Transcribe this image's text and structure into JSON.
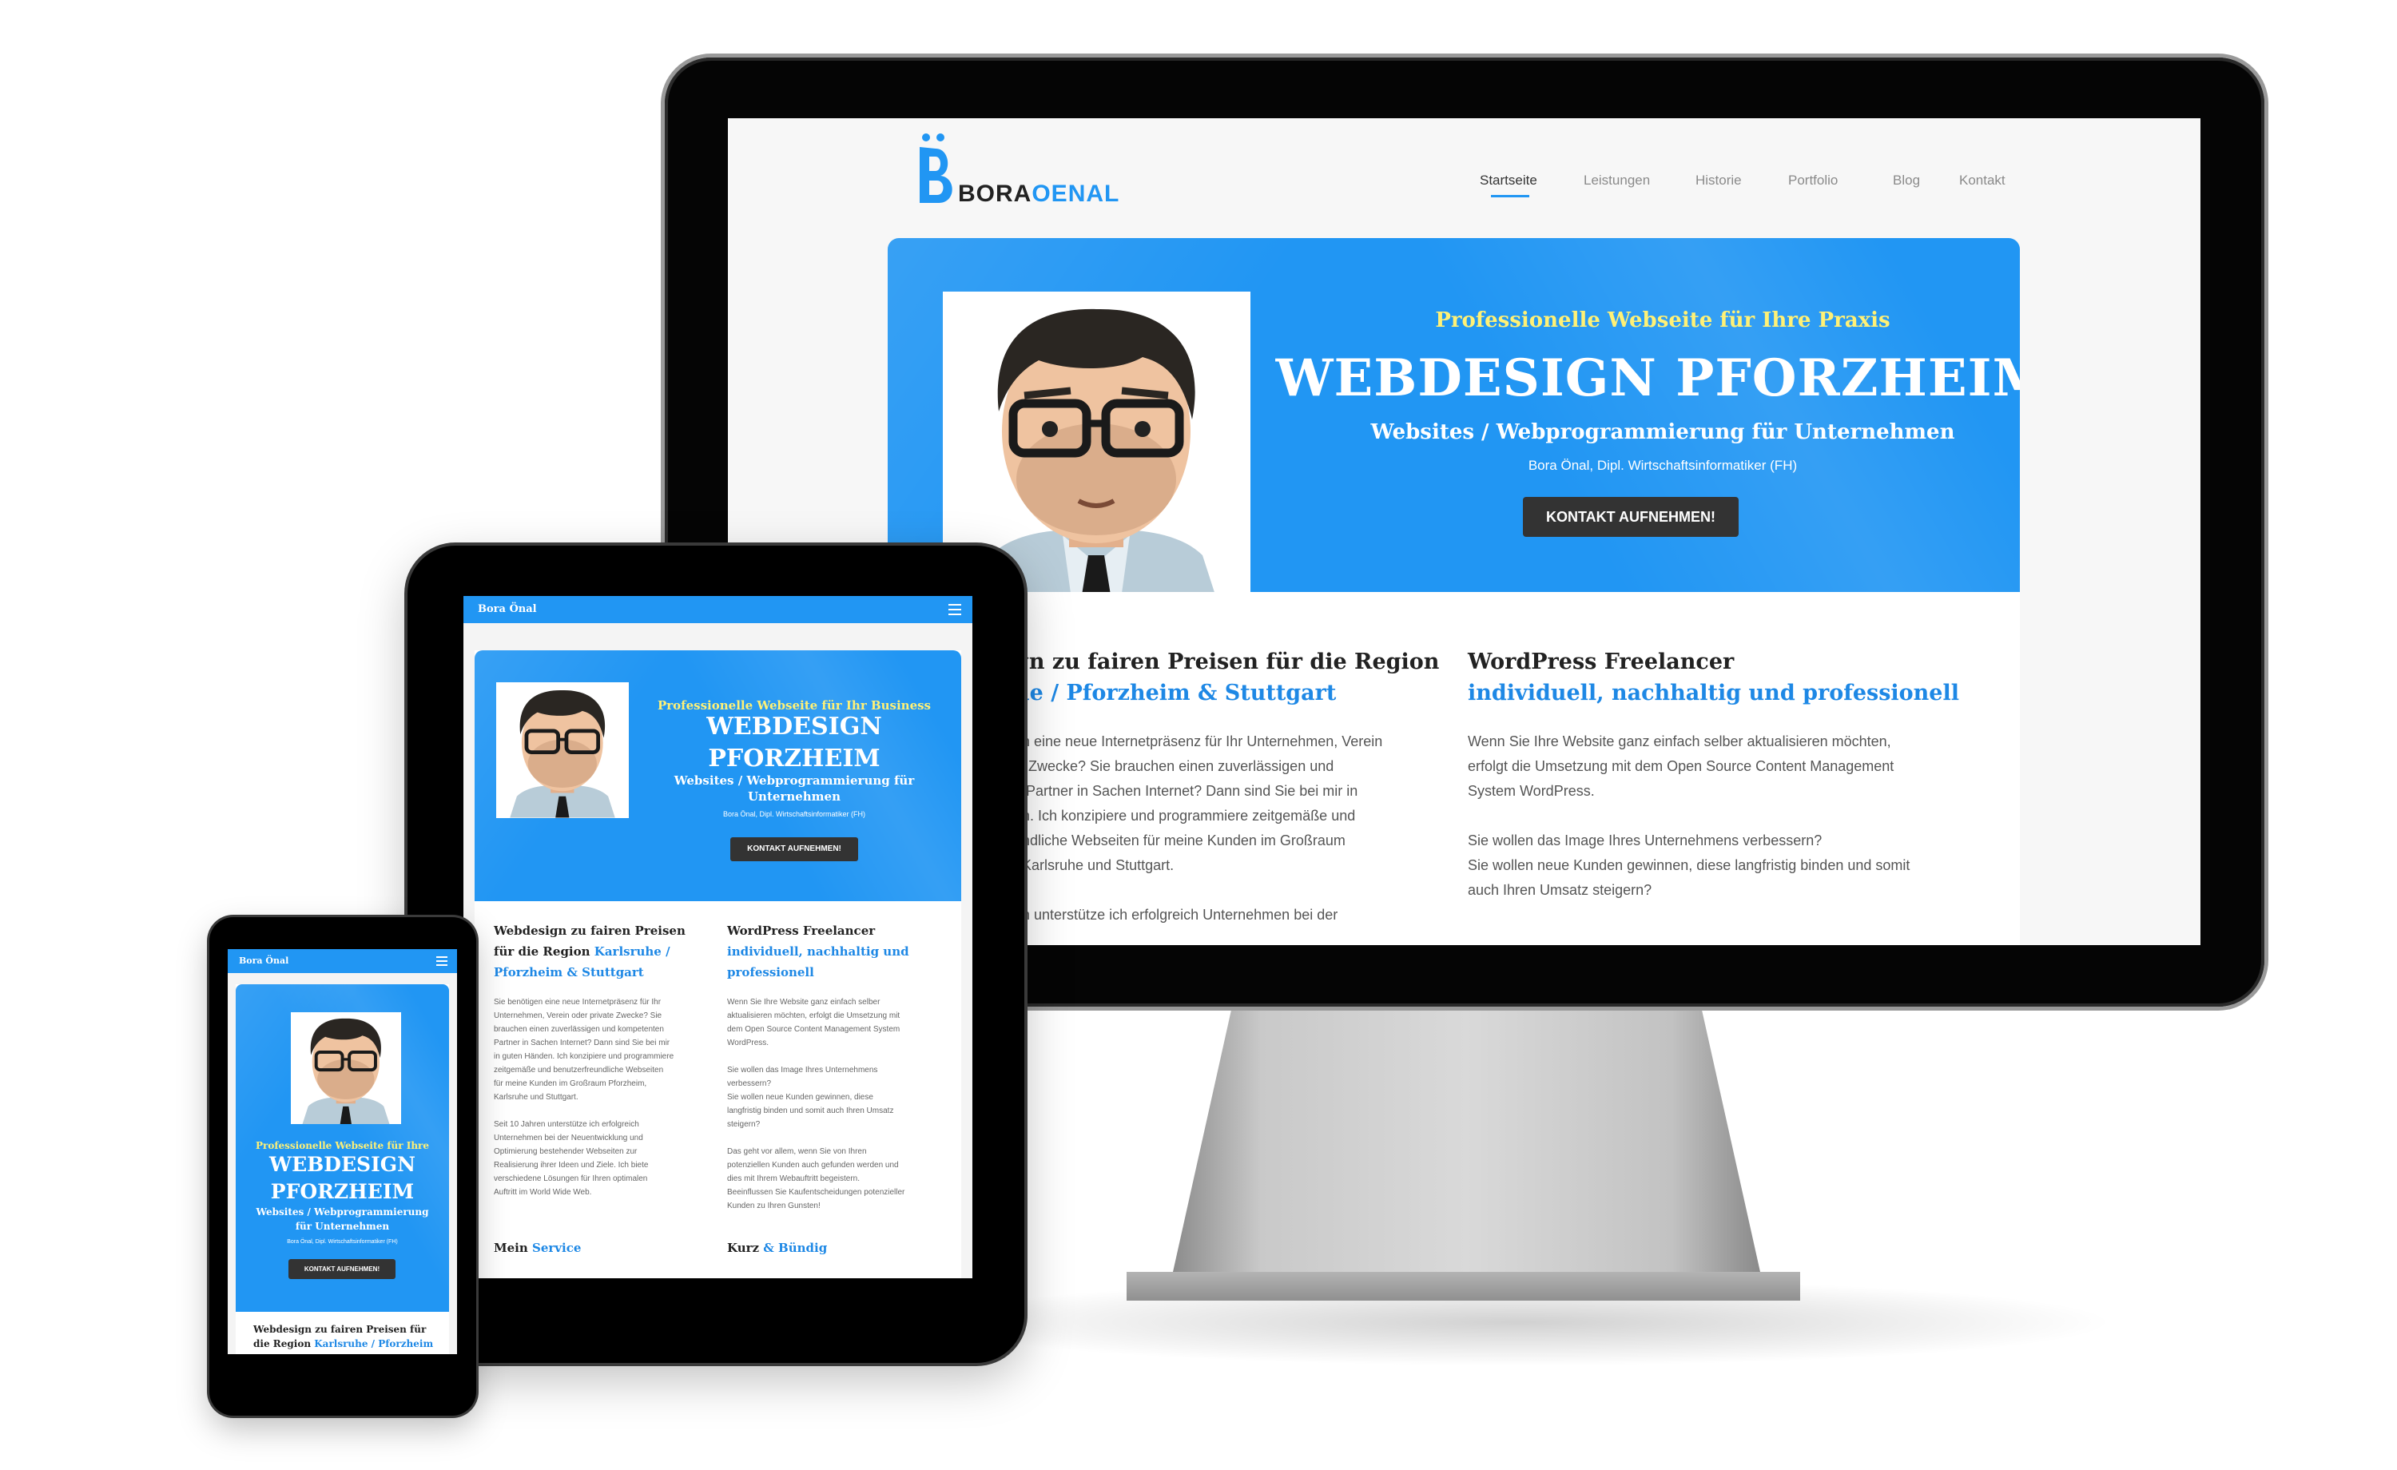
{
  "desktop": {
    "logo": {
      "part1": "BORA",
      "part2": "OENAL"
    },
    "nav": [
      "Startseite",
      "Leistungen",
      "Historie",
      "Portfolio",
      "Blog",
      "Kontakt"
    ],
    "hero": {
      "tagline": "Professionelle Webseite für Ihre Praxis",
      "title": "WEBDESIGN PFORZHEIM",
      "subtitle": "Websites / Webprogrammierung für Unternehmen",
      "byline": "Bora Önal, Dipl. Wirtschaftsinformatiker (FH)",
      "cta": "KONTAKT AUFNEHMEN!"
    },
    "col_left": {
      "heading": "gn zu fairen Preisen für die Region",
      "heading_blue": "he / Pforzheim & Stuttgart",
      "lines": [
        "en eine neue Internetpräsenz für Ihr Unternehmen, Verein",
        "Zwecke? Sie brauchen einen zuverlässigen und",
        "n Partner in Sachen Internet? Dann sind Sie bei mir in",
        "en. Ich konzipiere und programmiere zeitgemäße und",
        "undliche Webseiten für meine Kunden im Großraum",
        "Karlsruhe und Stuttgart.",
        "",
        "en unterstütze ich erfolgreich Unternehmen bei der"
      ]
    },
    "col_right": {
      "heading": "WordPress Freelancer",
      "heading_blue": "individuell, nachhaltig und professionell",
      "lines": [
        "Wenn Sie Ihre Website ganz einfach selber aktualisieren möchten,",
        "erfolgt die Umsetzung mit dem Open Source Content Management",
        "System WordPress.",
        "",
        "Sie wollen das Image Ihres Unternehmens verbessern?",
        "Sie wollen neue Kunden gewinnen, diese langfristig binden und somit",
        "auch Ihren Umsatz steigern?"
      ]
    }
  },
  "tablet": {
    "bar_title": "Bora Önal",
    "hero": {
      "tagline": "Professionelle Webseite für Ihr Business",
      "title_line1": "WEBDESIGN",
      "title_line2": "PFORZHEIM",
      "subtitle_line1": "Websites / Webprogrammierung für",
      "subtitle_line2": "Unternehmen",
      "byline": "Bora Önal, Dipl. Wirtschaftsinformatiker (FH)",
      "cta": "KONTAKT AUFNEHMEN!"
    },
    "col_left": {
      "heading": "Webdesign zu fairen Preisen für die Region",
      "heading_blue": "Karlsruhe / Pforzheim & Stuttgart",
      "lines": [
        "Sie benötigen eine neue Internetpräsenz für Ihr",
        "Unternehmen, Verein oder private Zwecke? Sie",
        "brauchen einen zuverlässigen und kompetenten",
        "Partner in Sachen Internet? Dann sind Sie bei mir",
        "in guten Händen. Ich konzipiere und programmiere",
        "zeitgemäße und benutzerfreundliche Webseiten",
        "für meine Kunden im Großraum Pforzheim,",
        "Karlsruhe und Stuttgart.",
        "",
        "Seit 10 Jahren unterstütze ich erfolgreich",
        "Unternehmen bei der Neuentwicklung und",
        "Optimierung bestehender Webseiten zur",
        "Realisierung ihrer Ideen und Ziele. Ich biete",
        "verschiedene Lösungen für Ihren optimalen",
        "Auftritt im World Wide Web."
      ],
      "next_heading": "Mein",
      "next_heading_blue": "Service"
    },
    "col_right": {
      "heading": "WordPress Freelancer",
      "heading_blue": "individuell, nachhaltig und professionell",
      "lines": [
        "Wenn Sie Ihre Website ganz einfach selber",
        "aktualisieren möchten, erfolgt die Umsetzung mit",
        "dem Open Source Content Management System",
        "WordPress.",
        "",
        "Sie wollen das Image Ihres Unternehmens",
        "verbessern?",
        "Sie wollen neue Kunden gewinnen, diese",
        "langfristig binden und somit auch Ihren Umsatz",
        "steigern?",
        "",
        "Das geht vor allem, wenn Sie von Ihren",
        "potenziellen Kunden auch gefunden werden und",
        "dies mit Ihrem Webauftritt begeistern.",
        "Beeinflussen Sie Kaufentscheidungen potenzieller",
        "Kunden zu Ihren Gunsten!"
      ],
      "next_heading": "Kurz",
      "next_heading_blue": "& Bündig"
    }
  },
  "phone": {
    "bar_title": "Bora Önal",
    "hero": {
      "tagline": "Professionelle Webseite für Ihre",
      "title_line1": "WEBDESIGN",
      "title_line2": "PFORZHEIM",
      "subtitle_line1": "Websites / Webprogrammierung",
      "subtitle_line2": "für Unternehmen",
      "byline": "Bora Önal, Dipl. Wirtschaftsinformatiker (FH)",
      "cta": "KONTAKT AUFNEHMEN!"
    },
    "heading_line1": "Webdesign zu fairen Preisen für",
    "heading_line2": "die Region",
    "heading_blue": "Karlsruhe / Pforzheim"
  }
}
